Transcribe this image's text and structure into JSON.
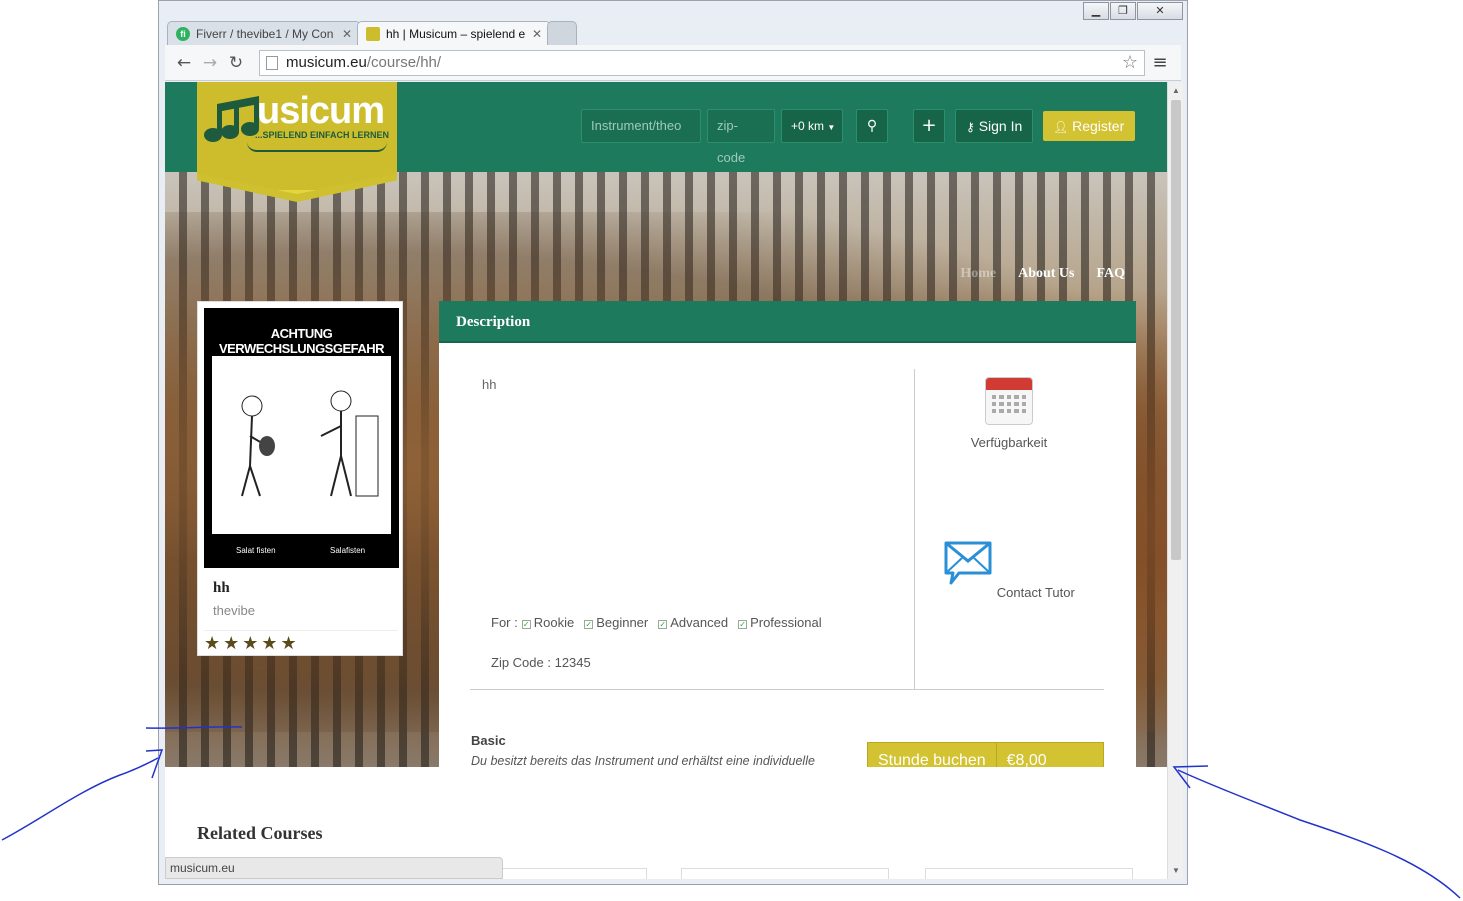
{
  "browser": {
    "tabs": [
      {
        "title": "Fiverr / thevibe1 / My Con",
        "close": "✕",
        "favicon": "fi"
      },
      {
        "title": "hh | Musicum – spielend e",
        "close": "✕"
      }
    ],
    "url_host": "musicum.eu",
    "url_path": "/course/hh/",
    "status_url": "musicum.eu"
  },
  "header": {
    "brand": "usicum",
    "tagline": "...SPIELEND EINFACH LERNEN",
    "search_instrument_placeholder": "Instrument/theo",
    "search_zip_placeholder": "zip-code",
    "distance": "+0 km",
    "sign_in": "Sign In",
    "register": "Register"
  },
  "subnav": [
    "Home",
    "About Us",
    "FAQ"
  ],
  "course_card": {
    "image_title": "ACHTUNG VERWECHSLUNGSGEFAHR",
    "caption_left": "Salat fisten",
    "caption_right": "Salafisten",
    "name": "hh",
    "tutor": "thevibe",
    "rating": 5,
    "stars": "★★★★★"
  },
  "description": {
    "heading": "Description",
    "text": "hh",
    "availability_label": "Verfügbarkeit",
    "contact_label": "Contact Tutor",
    "for_label": "For :",
    "levels": [
      "Rookie",
      "Beginner",
      "Advanced",
      "Professional"
    ],
    "zip_label": "Zip Code : 12345",
    "plan_title": "Basic",
    "plan_desc": "Du besitzt bereits das Instrument und erhältst eine individuelle Unterrichtsstunde in deiner Wohnung.",
    "book_label": "Stunde buchen",
    "price": "€8,00"
  },
  "related": {
    "title": "Related Courses"
  },
  "colors": {
    "brand_green": "#1e7a5c",
    "brand_yellow": "#d3c232",
    "annotation_blue": "#2233cc"
  }
}
